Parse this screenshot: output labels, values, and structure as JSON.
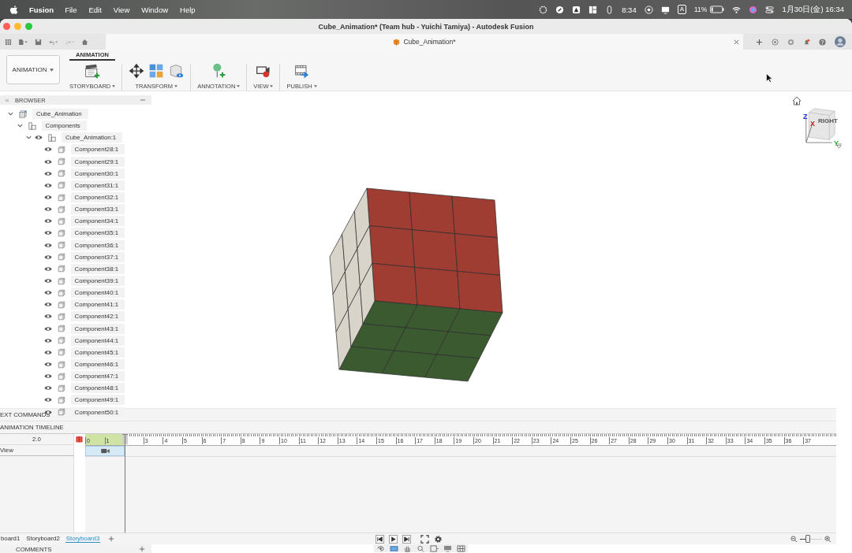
{
  "menu_bar": {
    "app": "Fusion",
    "menus": [
      "File",
      "Edit",
      "View",
      "Window",
      "Help"
    ],
    "clock": "8:34",
    "input_mode": "A",
    "battery": "11%",
    "datetime": "1月30日(金)  16:34"
  },
  "window": {
    "title": "Cube_Animation* (Team hub - Yuichi Tamiya) - Autodesk Fusion"
  },
  "document_tab": {
    "label": "Cube_Animation*"
  },
  "toolbar": {
    "workspace": "ANIMATION",
    "tabs": [
      {
        "label": "ANIMATION",
        "selected": true
      }
    ],
    "groups": [
      {
        "label": "STORYBOARD",
        "kind": "storyboard"
      },
      {
        "label": "TRANSFORM",
        "kind": "transform"
      },
      {
        "label": "ANNOTATION",
        "kind": "annotation"
      },
      {
        "label": "VIEW",
        "kind": "view"
      },
      {
        "label": "PUBLISH",
        "kind": "publish"
      }
    ]
  },
  "browser": {
    "title": "BROWSER",
    "tree": [
      {
        "label": "Cube_Animation",
        "kind": "document",
        "expanded": true,
        "children": [
          {
            "label": "Components",
            "kind": "folder",
            "expanded": true,
            "children": [
              {
                "label": "Cube_Animation:1",
                "kind": "assembly",
                "visible": true,
                "expanded": true,
                "children": [
                  {
                    "label": "Component28:1",
                    "kind": "body",
                    "visible": true
                  },
                  {
                    "label": "Component29:1",
                    "kind": "body",
                    "visible": true
                  },
                  {
                    "label": "Component30:1",
                    "kind": "body",
                    "visible": true
                  },
                  {
                    "label": "Component31:1",
                    "kind": "body",
                    "visible": true
                  },
                  {
                    "label": "Component32:1",
                    "kind": "body",
                    "visible": true
                  },
                  {
                    "label": "Component33:1",
                    "kind": "body",
                    "visible": true
                  },
                  {
                    "label": "Component34:1",
                    "kind": "body",
                    "visible": true
                  },
                  {
                    "label": "Component35:1",
                    "kind": "body",
                    "visible": true
                  },
                  {
                    "label": "Component36:1",
                    "kind": "body",
                    "visible": true
                  },
                  {
                    "label": "Component37:1",
                    "kind": "body",
                    "visible": true
                  },
                  {
                    "label": "Component38:1",
                    "kind": "body",
                    "visible": true
                  },
                  {
                    "label": "Component39:1",
                    "kind": "body",
                    "visible": true
                  },
                  {
                    "label": "Component40:1",
                    "kind": "body",
                    "visible": true
                  },
                  {
                    "label": "Component41:1",
                    "kind": "body",
                    "visible": true
                  },
                  {
                    "label": "Component42:1",
                    "kind": "body",
                    "visible": true
                  },
                  {
                    "label": "Component43:1",
                    "kind": "body",
                    "visible": true
                  },
                  {
                    "label": "Component44:1",
                    "kind": "body",
                    "visible": true
                  },
                  {
                    "label": "Component45:1",
                    "kind": "body",
                    "visible": true
                  },
                  {
                    "label": "Component46:1",
                    "kind": "body",
                    "visible": true
                  },
                  {
                    "label": "Component47:1",
                    "kind": "body",
                    "visible": true
                  },
                  {
                    "label": "Component48:1",
                    "kind": "body",
                    "visible": true
                  },
                  {
                    "label": "Component49:1",
                    "kind": "body",
                    "visible": true
                  },
                  {
                    "label": "Component50:1",
                    "kind": "body",
                    "visible": true
                  }
                ]
              }
            ]
          }
        ]
      }
    ]
  },
  "view_cube": {
    "face": "RIGHT",
    "axes": [
      "Z",
      "X",
      "Y"
    ]
  },
  "text_commands": {
    "label": "EXT COMMANDS"
  },
  "timeline": {
    "title": "ANIMATION TIMELINE",
    "duration": "2.0",
    "tracks": [
      {
        "label": "View"
      }
    ],
    "ruler_labels": [
      "0",
      "1",
      "3",
      "4",
      "5",
      "6",
      "7",
      "8",
      "9",
      "10",
      "11",
      "12",
      "13",
      "14",
      "15",
      "16",
      "17",
      "18",
      "19",
      "20",
      "21",
      "22",
      "23",
      "24",
      "25",
      "26",
      "27",
      "28",
      "29",
      "30",
      "31",
      "32",
      "33",
      "34",
      "35",
      "36",
      "37"
    ],
    "playhead": {
      "level": 0.053
    }
  },
  "storyboards": [
    {
      "label": "board1",
      "selected": false
    },
    {
      "label": "Storyboard2",
      "selected": false
    },
    {
      "label": "Storyboard3",
      "selected": true
    }
  ],
  "comments": {
    "label": "COMMENTS"
  },
  "zoom": {
    "level": 0.35
  }
}
